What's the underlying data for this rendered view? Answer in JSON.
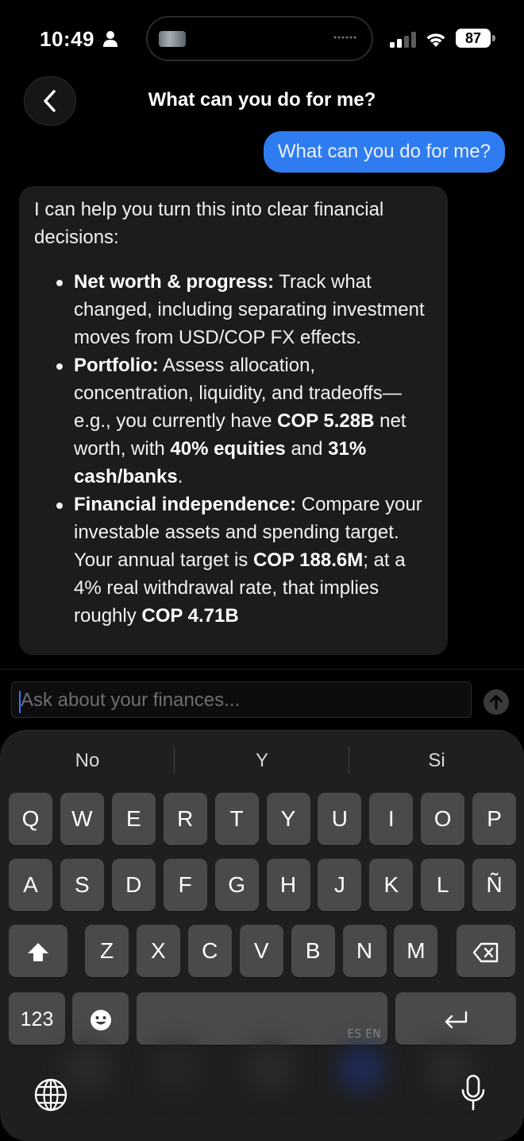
{
  "status_bar": {
    "time": "10:49",
    "battery": "87"
  },
  "header": {
    "title": "What can you do for me?"
  },
  "conversation": {
    "user_message": "What can you do for me?",
    "assistant": {
      "intro": "I can help you turn this into clear financial decisions:",
      "bullets": [
        {
          "parts": [
            {
              "text": "Net worth & progress:",
              "bold": true
            },
            {
              "text": " Track what changed, including separating investment moves from USD/COP FX effects.",
              "bold": false
            }
          ]
        },
        {
          "parts": [
            {
              "text": "Portfolio:",
              "bold": true
            },
            {
              "text": " Assess allocation, concentration, liquidity, and tradeoffs—e.g., you currently have ",
              "bold": false
            },
            {
              "text": "COP 5.28B",
              "bold": true
            },
            {
              "text": " net worth, with ",
              "bold": false
            },
            {
              "text": "40% equities",
              "bold": true
            },
            {
              "text": " and ",
              "bold": false
            },
            {
              "text": "31% cash/banks",
              "bold": true
            },
            {
              "text": ".",
              "bold": false
            }
          ]
        },
        {
          "parts": [
            {
              "text": "Financial independence:",
              "bold": true
            },
            {
              "text": " Compare your investable assets and spending target. Your annual target is ",
              "bold": false
            },
            {
              "text": "COP 188.6M",
              "bold": true
            },
            {
              "text": "; at a 4% real withdrawal rate, that implies roughly ",
              "bold": false
            },
            {
              "text": "COP 4.71B",
              "bold": true
            }
          ]
        }
      ]
    }
  },
  "composer": {
    "placeholder": "Ask about your finances..."
  },
  "keyboard": {
    "suggestions": [
      "No",
      "Y",
      "Si"
    ],
    "rows": [
      [
        "Q",
        "W",
        "E",
        "R",
        "T",
        "Y",
        "U",
        "I",
        "O",
        "P"
      ],
      [
        "A",
        "S",
        "D",
        "F",
        "G",
        "H",
        "J",
        "K",
        "L",
        "Ñ"
      ],
      [
        "Z",
        "X",
        "C",
        "V",
        "B",
        "N",
        "M"
      ]
    ],
    "numbers_key": "123",
    "space_languages": "ES EN"
  }
}
